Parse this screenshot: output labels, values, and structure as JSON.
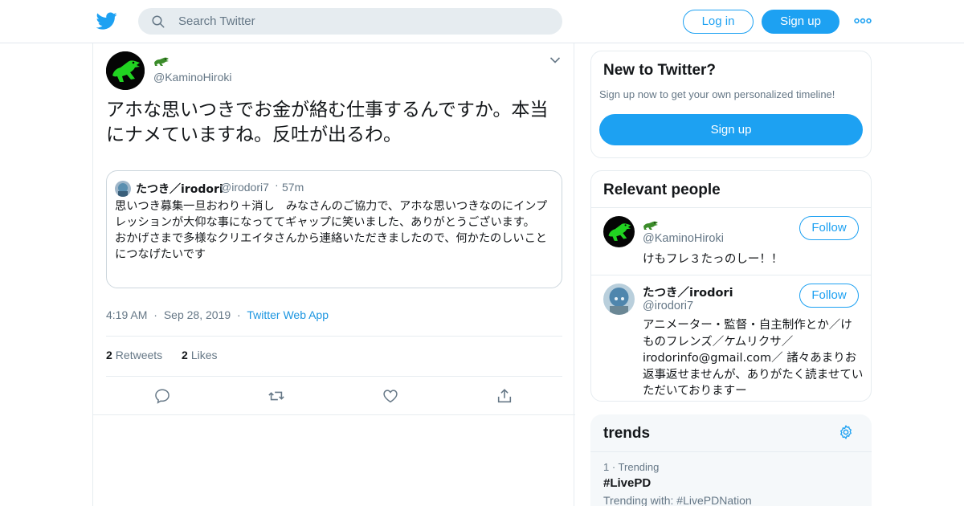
{
  "header": {
    "logo_icon": "twitter-bird-icon",
    "search": {
      "placeholder": "Search Twitter"
    },
    "login_label": "Log in",
    "signup_label": "Sign up",
    "more_icon": "more-dots-icon",
    "accent": "#1da1f2"
  },
  "tweet": {
    "author_handle": "@KaminoHiroki",
    "author_name_icon": "crocodile-emoji",
    "text": "アホな思いつきでお金が絡む仕事するんですか。本当にナメていますね。反吐が出るわ。",
    "quote": {
      "name": "たつき／irodori",
      "handle": "@irodori7",
      "sep": "·",
      "time": "57m",
      "text": "思いつき募集一旦おわり＋消し　みなさんのご協力で、アホな思いつきなのにインプレッションが大仰な事になっててギャップに笑いました、ありがとうございます。\nおかげさまで多様なクリエイタさんから連絡いただきましたので、何かたのしいことにつなげたいです"
    },
    "time": "4:19 AM",
    "sep": "·",
    "date": "Sep 28, 2019",
    "source": "Twitter Web App",
    "retweets_count": "2",
    "retweets_label": "Retweets",
    "likes_count": "2",
    "likes_label": "Likes"
  },
  "sidebar": {
    "new_to_twitter": {
      "title": "New to Twitter?",
      "subtitle": "Sign up now to get your own personalized timeline!",
      "signup_label": "Sign up"
    },
    "relevant_people": {
      "title": "Relevant people",
      "people": [
        {
          "name_icon": "crocodile-emoji",
          "handle": "@KaminoHiroki",
          "bio": "けもフレ３たっのしー！！",
          "follow_label": "Follow"
        },
        {
          "name": "たつき／irodori",
          "handle": "@irodori7",
          "bio": "アニメーター・監督・自主制作とか／けものフレンズ／ケムリクサ／irodorinfo@gmail.com／ 諸々あまりお返事返せませんが、ありがたく読ませていただいておりますー",
          "follow_label": "Follow"
        }
      ]
    },
    "trends": {
      "title": "trends",
      "items": [
        {
          "rank": "1 · Trending",
          "name": "#LivePD",
          "with": "Trending with: #LivePDNation"
        }
      ]
    }
  }
}
